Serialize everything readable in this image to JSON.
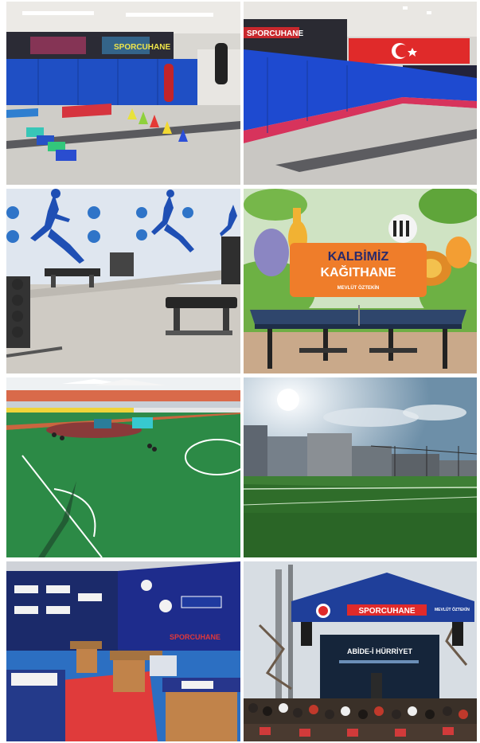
{
  "gallery": {
    "tile1": {
      "banner_text": "SPORCUHANE"
    },
    "tile2": {
      "banner_text": "SPORCUHANE"
    },
    "tile3": {},
    "tile4": {
      "sign_line1": "KALBİMİZ",
      "sign_line2": "KAĞITHANE",
      "sign_line3": "MEVLÜT ÖZTEKİN"
    },
    "tile5": {},
    "tile6": {},
    "tile7": {
      "wall_text": "SPORCUHANE"
    },
    "tile8": {
      "stage_brand": "SPORCUHANE",
      "stage_side": "MEVLÜT ÖZTEKİN",
      "screen_title": "ABİDE-İ HÜRRİYET"
    }
  }
}
